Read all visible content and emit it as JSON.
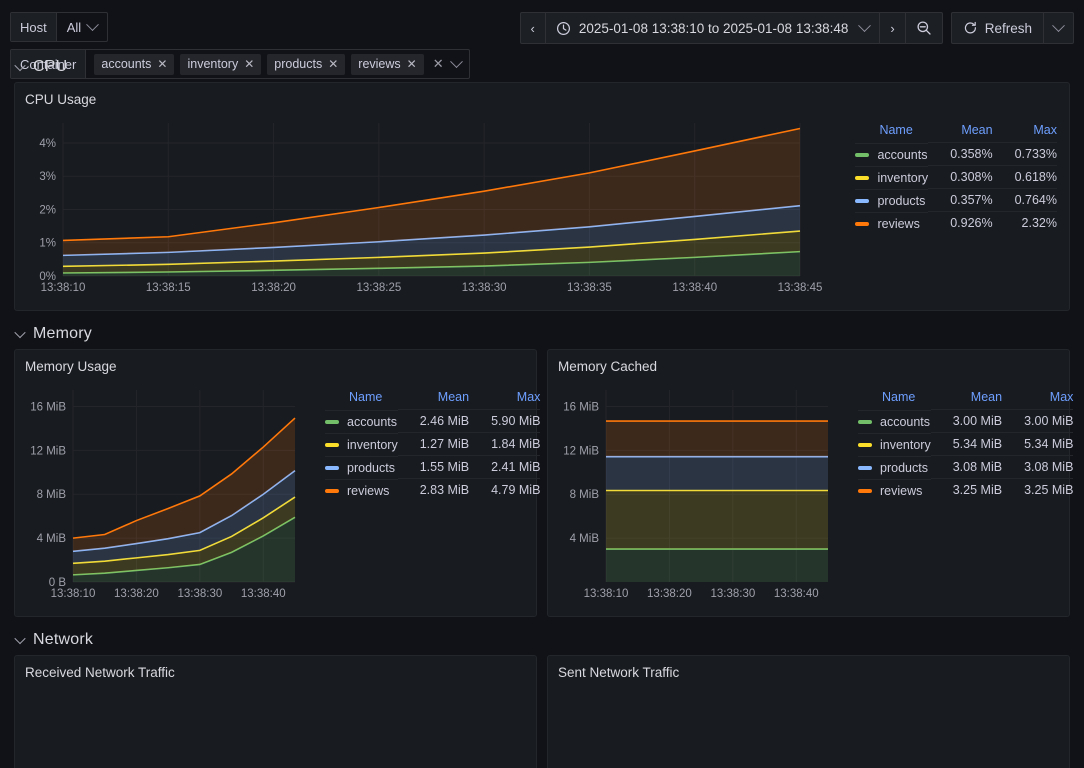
{
  "variables": [
    {
      "name": "host",
      "label": "Host",
      "type": "single",
      "value": "All"
    },
    {
      "name": "container",
      "label": "Container",
      "type": "multi",
      "values": [
        "accounts",
        "inventory",
        "products",
        "reviews"
      ]
    }
  ],
  "timepicker": {
    "prev_label": "‹",
    "next_label": "›",
    "range": "2025-01-08 13:38:10 to 2025-01-08 13:38:48",
    "clock_icon": "clock-icon",
    "zoom_out_icon": "zoom-out-icon",
    "refresh_label": "Refresh",
    "refresh_icon": "refresh-icon"
  },
  "colors": {
    "accounts": "#73BF69",
    "inventory": "#FADE2A",
    "products": "#8AB8FF",
    "reviews": "#FF780A",
    "panel_bg": "#181b1f",
    "page_bg": "#111217",
    "accent": "#6e9fff"
  },
  "rows": [
    {
      "name": "cpu",
      "title": "CPU",
      "collapsed": false
    },
    {
      "name": "memory",
      "title": "Memory",
      "collapsed": false
    },
    {
      "name": "network",
      "title": "Network",
      "collapsed": false
    }
  ],
  "panels": {
    "cpu_usage": {
      "title": "CPU Usage"
    },
    "memory_usage": {
      "title": "Memory Usage"
    },
    "memory_cached": {
      "title": "Memory Cached"
    },
    "received_network_traffic": {
      "title": "Received Network Traffic"
    },
    "sent_network_traffic": {
      "title": "Sent Network Traffic"
    }
  },
  "legend_headers": {
    "name": "Name",
    "mean": "Mean",
    "max": "Max"
  },
  "chart_data": [
    {
      "panel": "cpu_usage",
      "type": "area",
      "stacked": true,
      "title": "CPU Usage",
      "xlabel": "",
      "ylabel": "",
      "grid": true,
      "legend_position": "right-table",
      "x": [
        "13:38:10",
        "13:38:15",
        "13:38:20",
        "13:38:25",
        "13:38:30",
        "13:38:35",
        "13:38:40",
        "13:38:45"
      ],
      "xtick_labels": [
        "13:38:10",
        "13:38:15",
        "13:38:20",
        "13:38:25",
        "13:38:30",
        "13:38:35",
        "13:38:40",
        "13:38:45"
      ],
      "ytick_labels": [
        "0%",
        "1%",
        "2%",
        "3%",
        "4%"
      ],
      "ytick_values": [
        0,
        1,
        2,
        3,
        4
      ],
      "ylim": [
        0,
        4.6
      ],
      "series": [
        {
          "name": "accounts",
          "color": "#73BF69",
          "mean": "0.358%",
          "max": "0.733%",
          "values": [
            0.09,
            0.12,
            0.17,
            0.23,
            0.3,
            0.41,
            0.56,
            0.733
          ]
        },
        {
          "name": "inventory",
          "color": "#FADE2A",
          "mean": "0.308%",
          "max": "0.618%",
          "values": [
            0.2,
            0.23,
            0.28,
            0.33,
            0.39,
            0.46,
            0.54,
            0.618
          ]
        },
        {
          "name": "products",
          "color": "#8AB8FF",
          "mean": "0.357%",
          "max": "0.764%",
          "values": [
            0.33,
            0.36,
            0.41,
            0.47,
            0.54,
            0.61,
            0.69,
            0.764
          ]
        },
        {
          "name": "reviews",
          "color": "#FF780A",
          "mean": "0.926%",
          "max": "2.32%",
          "values": [
            0.45,
            0.47,
            0.74,
            1.03,
            1.32,
            1.62,
            1.97,
            2.32
          ]
        }
      ]
    },
    {
      "panel": "memory_usage",
      "type": "area",
      "stacked": true,
      "title": "Memory Usage",
      "xlabel": "",
      "ylabel": "",
      "grid": true,
      "legend_position": "right-table",
      "x": [
        "13:38:10",
        "13:38:15",
        "13:38:20",
        "13:38:25",
        "13:38:30",
        "13:38:35",
        "13:38:40",
        "13:38:45"
      ],
      "xtick_labels": [
        "13:38:10",
        "13:38:20",
        "13:38:30",
        "13:38:40"
      ],
      "ytick_labels": [
        "0 B",
        "4 MiB",
        "8 MiB",
        "12 MiB",
        "16 MiB"
      ],
      "ytick_values": [
        0,
        4,
        8,
        12,
        16
      ],
      "ylim": [
        0,
        17.5
      ],
      "unit": "MiB",
      "series": [
        {
          "name": "accounts",
          "color": "#73BF69",
          "mean": "2.46 MiB",
          "max": "5.90 MiB",
          "values": [
            0.65,
            0.8,
            1.05,
            1.3,
            1.6,
            2.7,
            4.2,
            5.9
          ]
        },
        {
          "name": "inventory",
          "color": "#FADE2A",
          "mean": "1.27 MiB",
          "max": "1.84 MiB",
          "values": [
            1.05,
            1.1,
            1.15,
            1.2,
            1.28,
            1.45,
            1.65,
            1.84
          ]
        },
        {
          "name": "products",
          "color": "#8AB8FF",
          "mean": "1.55 MiB",
          "max": "2.41 MiB",
          "values": [
            1.1,
            1.18,
            1.3,
            1.45,
            1.62,
            1.9,
            2.15,
            2.41
          ]
        },
        {
          "name": "reviews",
          "color": "#FF780A",
          "mean": "2.83 MiB",
          "max": "4.79 MiB",
          "values": [
            1.2,
            1.25,
            2.1,
            2.75,
            3.35,
            3.8,
            4.3,
            4.79
          ]
        }
      ]
    },
    {
      "panel": "memory_cached",
      "type": "area",
      "stacked": true,
      "title": "Memory Cached",
      "xlabel": "",
      "ylabel": "",
      "grid": true,
      "legend_position": "right-table",
      "x": [
        "13:38:10",
        "13:38:15",
        "13:38:20",
        "13:38:25",
        "13:38:30",
        "13:38:35",
        "13:38:40",
        "13:38:45"
      ],
      "xtick_labels": [
        "13:38:10",
        "13:38:20",
        "13:38:30",
        "13:38:40"
      ],
      "ytick_labels": [
        "4 MiB",
        "8 MiB",
        "12 MiB",
        "16 MiB"
      ],
      "ytick_values": [
        4,
        8,
        12,
        16
      ],
      "ylim": [
        0,
        17.5
      ],
      "unit": "MiB",
      "series": [
        {
          "name": "accounts",
          "color": "#73BF69",
          "mean": "3.00 MiB",
          "max": "3.00 MiB",
          "values": [
            3.0,
            3.0,
            3.0,
            3.0,
            3.0,
            3.0,
            3.0,
            3.0
          ]
        },
        {
          "name": "inventory",
          "color": "#FADE2A",
          "mean": "5.34 MiB",
          "max": "5.34 MiB",
          "values": [
            5.34,
            5.34,
            5.34,
            5.34,
            5.34,
            5.34,
            5.34,
            5.34
          ]
        },
        {
          "name": "products",
          "color": "#8AB8FF",
          "mean": "3.08 MiB",
          "max": "3.08 MiB",
          "values": [
            3.08,
            3.08,
            3.08,
            3.08,
            3.08,
            3.08,
            3.08,
            3.08
          ]
        },
        {
          "name": "reviews",
          "color": "#FF780A",
          "mean": "3.25 MiB",
          "max": "3.25 MiB",
          "values": [
            3.25,
            3.25,
            3.25,
            3.25,
            3.25,
            3.25,
            3.25,
            3.25
          ]
        }
      ]
    }
  ]
}
